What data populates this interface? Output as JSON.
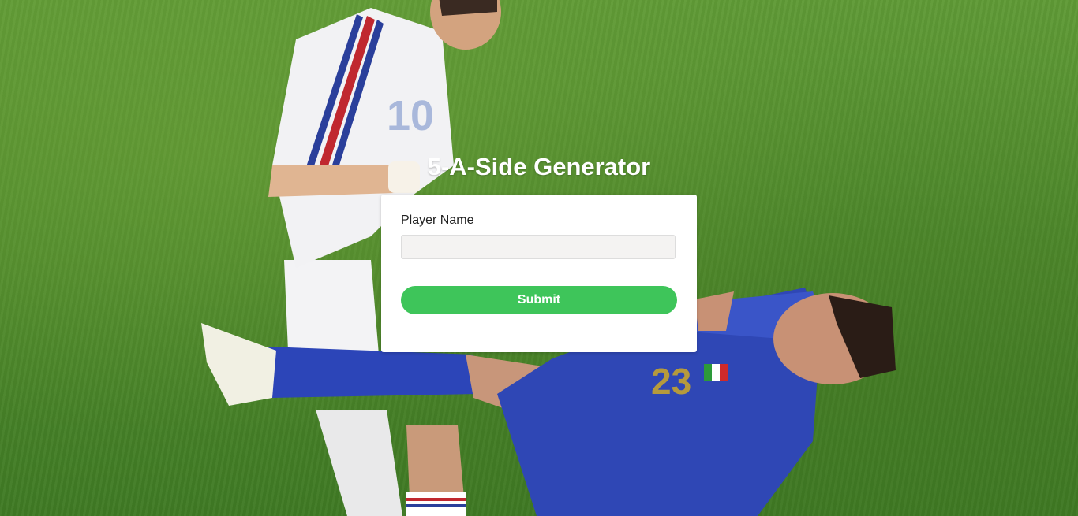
{
  "page": {
    "title": "5-A-Side Generator"
  },
  "form": {
    "label": "Player Name",
    "input_value": "",
    "placeholder": "",
    "submit_label": "Submit"
  },
  "colors": {
    "accent": "#3ec55a",
    "card": "#ffffff",
    "input_bg": "#f4f3f2",
    "grass": "#4f8a2c"
  },
  "background": {
    "jersey_number_left": "10",
    "jersey_number_right": "23"
  }
}
